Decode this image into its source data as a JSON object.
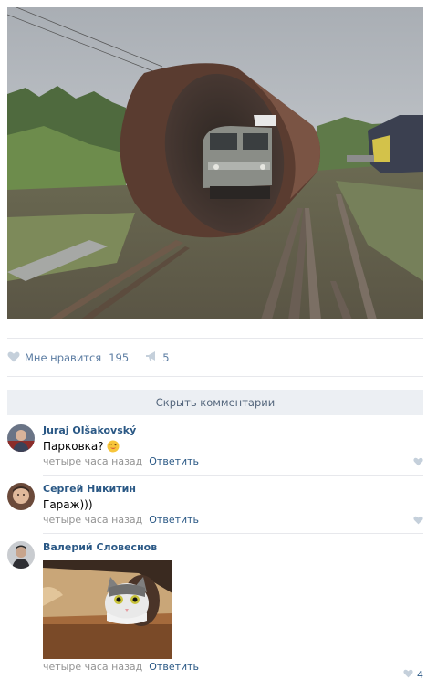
{
  "post": {
    "actions": {
      "like_label": "Мне нравится",
      "like_count": "195",
      "share_count": "5",
      "like_icon": "heart-icon",
      "share_icon": "megaphone-icon"
    },
    "hide_comments_label": "Скрыть комментарии"
  },
  "comments": [
    {
      "author": "Juraj Olšakovský",
      "text": "Парковка?",
      "emoji": "winking-face-emoji",
      "time": "четыре часа назад",
      "reply_label": "Ответить",
      "likes": ""
    },
    {
      "author": "Сергей Никитин",
      "text": "Гараж)))",
      "time": "четыре часа назад",
      "reply_label": "Ответить",
      "likes": ""
    },
    {
      "author": "Валерий Словеснов",
      "text": "",
      "time": "четыре часа назад",
      "reply_label": "Ответить",
      "likes": "4"
    }
  ],
  "colors": {
    "link": "#2a5885",
    "action": "#5b7ca2",
    "meta": "#939393",
    "bar": "#eceff3",
    "heart": "#c5d0db"
  }
}
